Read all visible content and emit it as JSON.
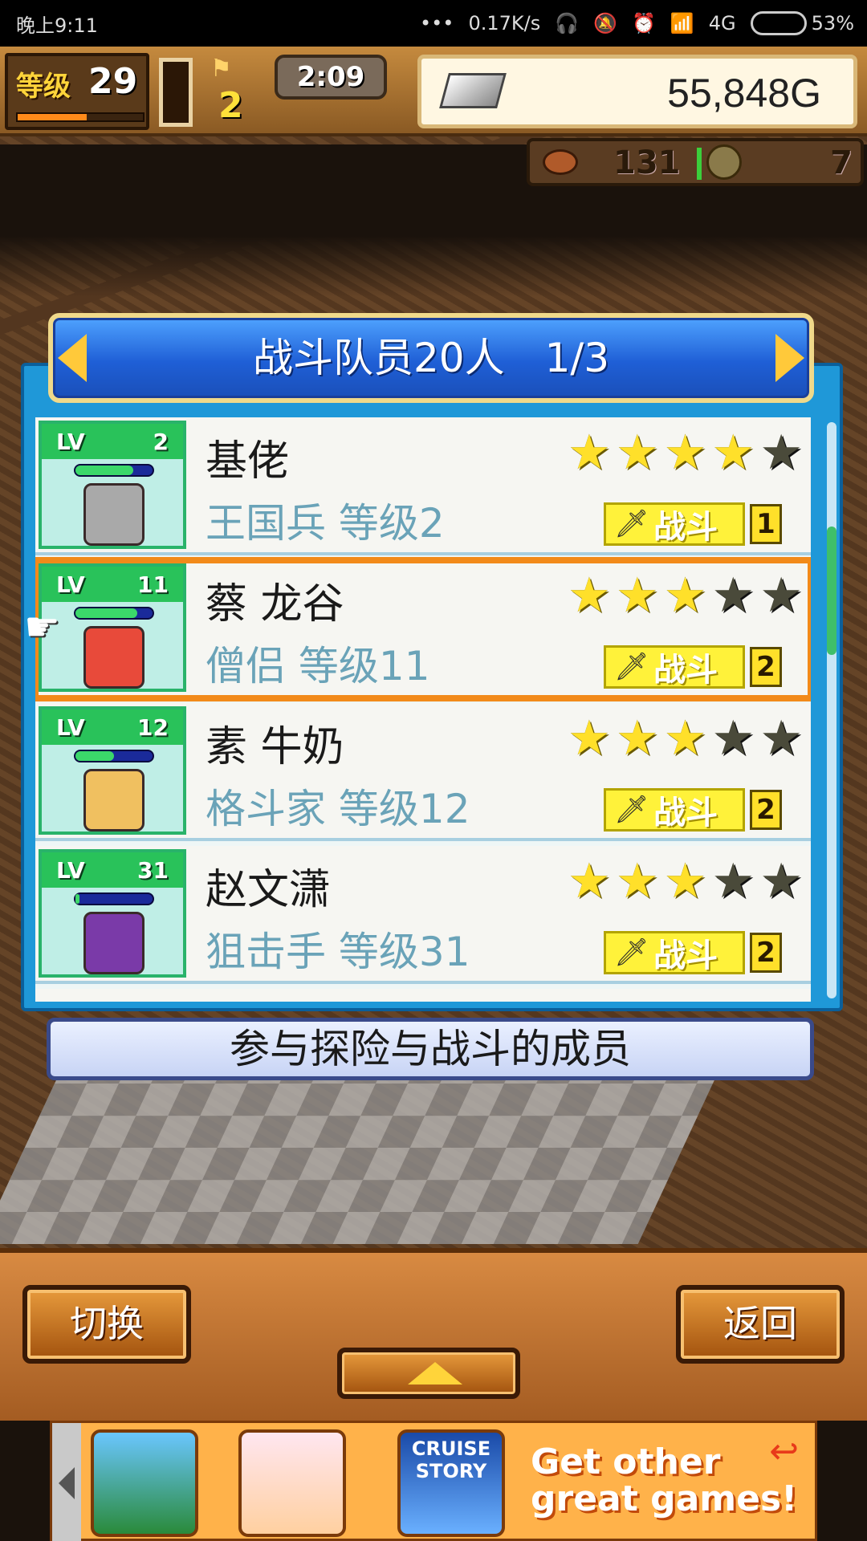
{
  "status_bar": {
    "time": "晚上9:11",
    "network_speed": "0.17K/s",
    "network_type": "4G",
    "battery": "53%",
    "battery_level": 0.53
  },
  "hud": {
    "level_label": "等级",
    "level_value": "29",
    "level_progress": 0.55,
    "event_count": "2",
    "timer": "2:09",
    "gold": "55,848G",
    "food": "131",
    "medals": "7"
  },
  "panel": {
    "title": "战斗队员20人　1/3",
    "caption": "参与探险与战斗的成员"
  },
  "members": [
    {
      "lv_label": "LV",
      "level": "2",
      "name": "基佬",
      "class_level": "王国兵 等级2",
      "stars": 4,
      "battle_label": "战斗",
      "battle_count": "1",
      "hp": 0.75,
      "sprite_color": "#a9a9a9"
    },
    {
      "lv_label": "LV",
      "level": "11",
      "name": "蔡 龙谷",
      "class_level": "僧侣 等级11",
      "stars": 3,
      "battle_label": "战斗",
      "battle_count": "2",
      "hp": 0.8,
      "sprite_color": "#e84a3a"
    },
    {
      "lv_label": "LV",
      "level": "12",
      "name": "素 牛奶",
      "class_level": "格斗家 等级12",
      "stars": 3,
      "battle_label": "战斗",
      "battle_count": "2",
      "hp": 0.5,
      "sprite_color": "#f0c060"
    },
    {
      "lv_label": "LV",
      "level": "31",
      "name": "赵文潇",
      "class_level": "狙击手 等级31",
      "stars": 3,
      "battle_label": "战斗",
      "battle_count": "2",
      "hp": 0.05,
      "sprite_color": "#7a3aa8"
    }
  ],
  "selected_member_index": 1,
  "buttons": {
    "switch": "切换",
    "back": "返回"
  },
  "ad": {
    "app3_title": "CRUISE STORY",
    "text": "Get other great games!"
  },
  "colors": {
    "accent_orange": "#f28a1a",
    "panel_blue": "#1f98d8",
    "star_on": "#ffe02a",
    "battle_tag": "#fff23a"
  }
}
